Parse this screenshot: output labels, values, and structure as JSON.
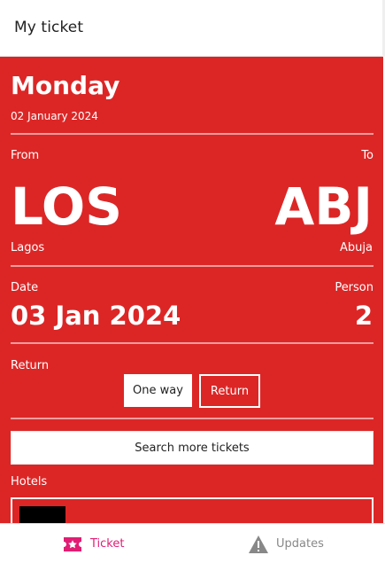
{
  "header": {
    "title": "My ticket"
  },
  "ticket": {
    "day": "Monday",
    "date_full": "02 January 2024",
    "from_label": "From",
    "to_label": "To",
    "from_code": "LOS",
    "to_code": "ABJ",
    "from_city": "Lagos",
    "to_city": "Abuja",
    "date_label": "Date",
    "person_label": "Person",
    "date_value": "03 Jan 2024",
    "person_value": "2",
    "return_label": "Return",
    "trip_options": {
      "one_way": "One way",
      "return": "Return"
    },
    "search_button": "Search more tickets",
    "hotels_label": "Hotels"
  },
  "nav": {
    "items": [
      {
        "label": "Ticket",
        "icon": "ticket-star-icon",
        "active": true
      },
      {
        "label": "Updates",
        "icon": "warning-triangle-icon",
        "active": false
      }
    ]
  },
  "colors": {
    "primary": "#dc2626",
    "active_nav": "#e11d74",
    "inactive_nav": "#888888"
  }
}
